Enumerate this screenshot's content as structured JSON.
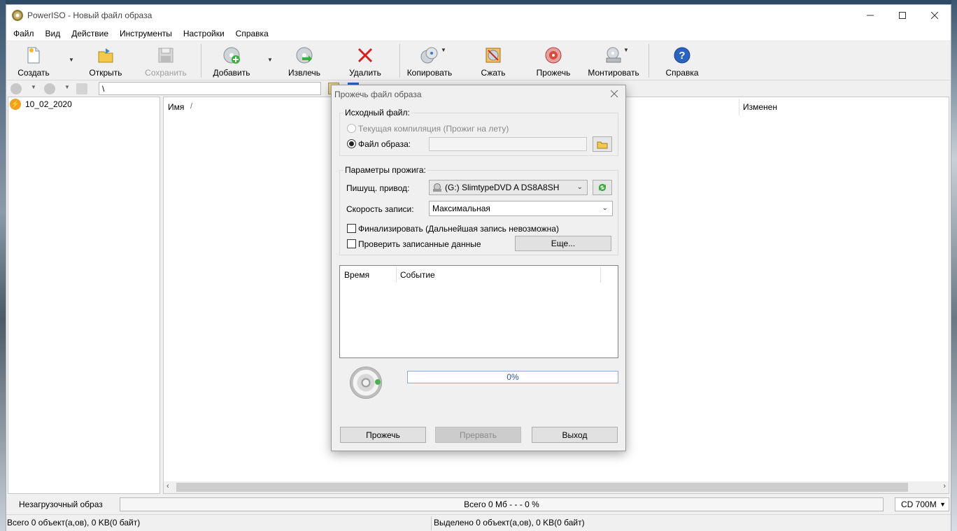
{
  "window": {
    "title": "PowerISO - Новый файл образа"
  },
  "menu": [
    "Файл",
    "Вид",
    "Действие",
    "Инструменты",
    "Настройки",
    "Справка"
  ],
  "toolbar": {
    "create": "Создать",
    "open": "Открыть",
    "save": "Сохранить",
    "add": "Добавить",
    "extract": "Извлечь",
    "delete": "Удалить",
    "copy": "Копировать",
    "compress": "Сжать",
    "burn": "Прожечь",
    "mount": "Монтировать",
    "help": "Справка"
  },
  "address": {
    "path": "\\"
  },
  "tree": {
    "root": "10_02_2020"
  },
  "list": {
    "col_name": "Имя",
    "sort_mark": "/",
    "col_modified": "Изменен"
  },
  "status": {
    "image_type": "Незагрузочный образ",
    "total": "Всего  0 Мб   - - -  0 %",
    "media": "CD 700M",
    "left": "Всего 0 объект(а,ов), 0 KB(0 байт)",
    "right": "Выделено 0 объект(а,ов), 0 KB(0 байт)"
  },
  "dialog": {
    "title": "Прожечь файл образа",
    "source_group": "Исходный файл:",
    "radio_current": "Текущая компиляция (Прожиг на лету)",
    "radio_image": "Файл образа:",
    "image_path": "",
    "params_group": "Параметры прожига:",
    "drive_label": "Пишущ. привод:",
    "drive_value": "(G:) SlimtypeDVD A  DS8A8SH",
    "speed_label": "Скорость записи:",
    "speed_value": "Максимальная",
    "finalize_label": "Финализировать (Дальнейшая запись невозможна)",
    "verify_label": "Проверить записанные данные",
    "more_button": "Еще...",
    "log_col_time": "Время",
    "log_col_event": "Событие",
    "progress": 0,
    "progress_text": "0%",
    "burn_button": "Прожечь",
    "abort_button": "Прервать",
    "exit_button": "Выход"
  }
}
